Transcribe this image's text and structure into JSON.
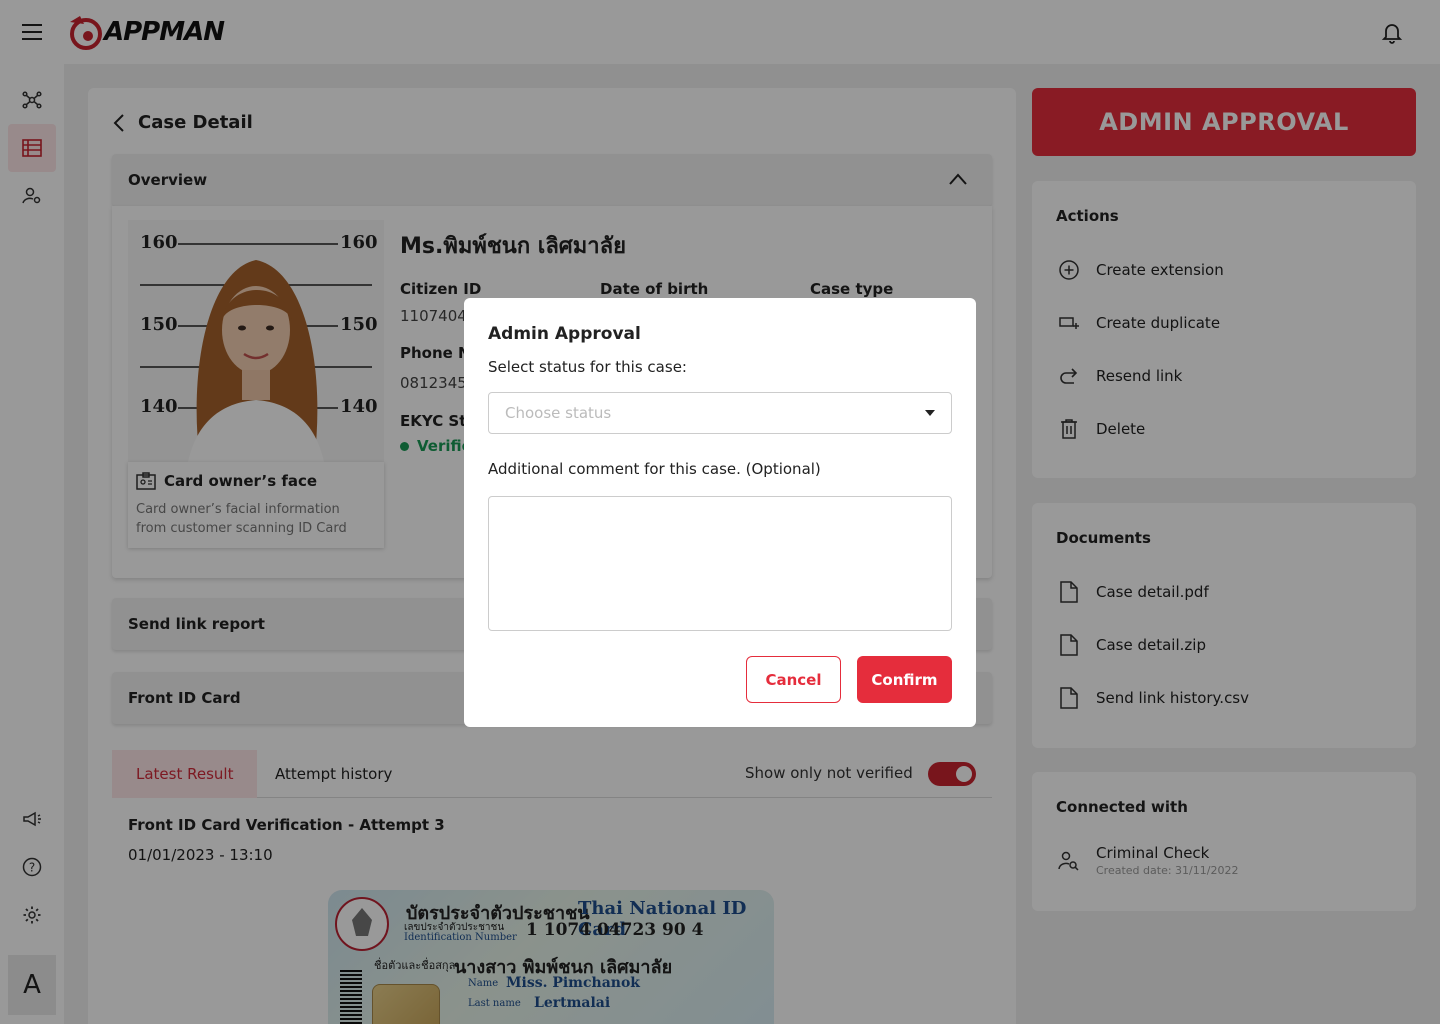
{
  "app": {
    "logo_text": "APPMAN"
  },
  "sidebar": {
    "items": [
      {
        "icon": "network-icon"
      },
      {
        "icon": "list-icon",
        "active": true
      },
      {
        "icon": "user-settings-icon"
      },
      {
        "icon": "megaphone-icon"
      },
      {
        "icon": "help-icon"
      },
      {
        "icon": "gear-icon"
      }
    ],
    "avatar_letter": "A"
  },
  "case": {
    "title": "Case Detail",
    "overview_label": "Overview",
    "name": "Ms.พิมพ์ชนก เลิศมาลัย",
    "fields": {
      "citizen_id_label": "Citizen ID",
      "citizen_id_value": "1107404",
      "dob_label": "Date of birth",
      "case_type_label": "Case type",
      "phone_label": "Phone N",
      "phone_value": "0812345",
      "ekyc_label": "EKYC Sta",
      "ekyc_value": "Verifie"
    },
    "mugshot": {
      "marks": [
        "160",
        "150",
        "140"
      ]
    },
    "face_card": {
      "title": "Card owner’s face",
      "desc_line1": "Card owner’s facial information",
      "desc_line2": "from customer scanning ID Card"
    },
    "send_link_label": "Send link report",
    "front_id_label": "Front ID Card",
    "tabs": [
      "Latest Result",
      "Attempt history"
    ],
    "toggle_label": "Show only not verified",
    "toggle_on": true,
    "attempt_title": "Front ID Card Verification - Attempt 3",
    "attempt_date": "01/01/2023 - 13:10",
    "id_card": {
      "th_title": "บัตรประจำตัวประชาชน",
      "en_title": "Thai National ID Card",
      "id_label_th": "เลขประจำตัวประชาชน",
      "id_label_en": "Identification Number",
      "id_number": "1 1074 04723 90 4",
      "name_label_th": "ชื่อตัวและชื่อสกุล",
      "name_th": "นางสาว พิมพ์ชนก เลิศมาลัย",
      "name_en_label": "Name",
      "name_en": "Miss. Pimchanok",
      "lastname_label": "Last name",
      "lastname": "Lertmalai"
    }
  },
  "right": {
    "admin_button": "ADMIN APPROVAL",
    "actions": {
      "heading": "Actions",
      "items": [
        "Create extension",
        "Create duplicate",
        "Resend link",
        "Delete"
      ]
    },
    "documents": {
      "heading": "Documents",
      "items": [
        "Case detail.pdf",
        "Case detail.zip",
        "Send link history.csv"
      ]
    },
    "connected": {
      "heading": "Connected with",
      "item": "Criminal Check",
      "created": "Created date: 31/11/2022"
    }
  },
  "modal": {
    "title": "Admin Approval",
    "select_label": "Select status for this case:",
    "select_placeholder": "Choose status",
    "comment_label": "Additional comment for this case. (Optional)",
    "comment_value": "",
    "cancel": "Cancel",
    "confirm": "Confirm"
  },
  "colors": {
    "accent": "#e52d3c",
    "success": "#1a9a55"
  }
}
